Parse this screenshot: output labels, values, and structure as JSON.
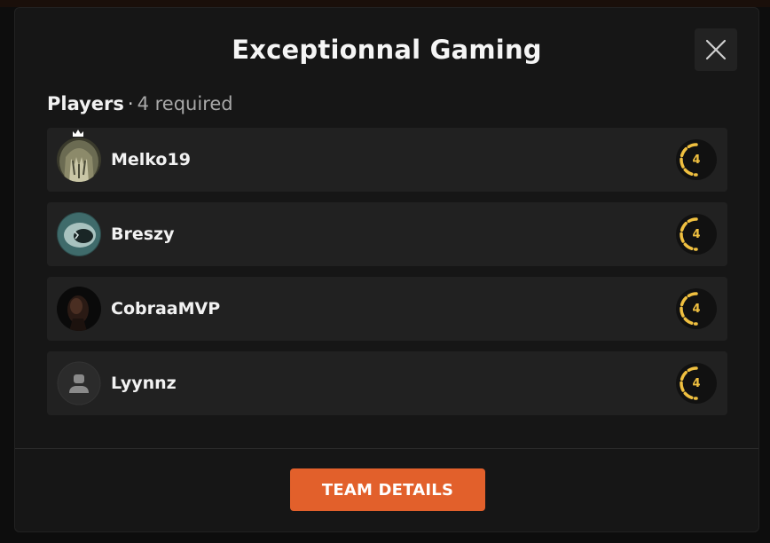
{
  "modal": {
    "title": "Exceptionnal Gaming",
    "players_label": "Players",
    "separator": "·",
    "required_text": "4 required",
    "button_label": "TEAM DETAILS"
  },
  "players": [
    {
      "name": "Melko19",
      "level": "4",
      "captain": true,
      "avatar": "hooded-figure"
    },
    {
      "name": "Breszy",
      "level": "4",
      "captain": false,
      "avatar": "shark"
    },
    {
      "name": "CobraaMVP",
      "level": "4",
      "captain": false,
      "avatar": "dark-portrait"
    },
    {
      "name": "Lyynnz",
      "level": "4",
      "captain": false,
      "avatar": "default-user"
    }
  ],
  "colors": {
    "accent": "#e2602b",
    "level": "#f0c040",
    "modal_bg": "#161616",
    "row_bg": "#212121"
  }
}
